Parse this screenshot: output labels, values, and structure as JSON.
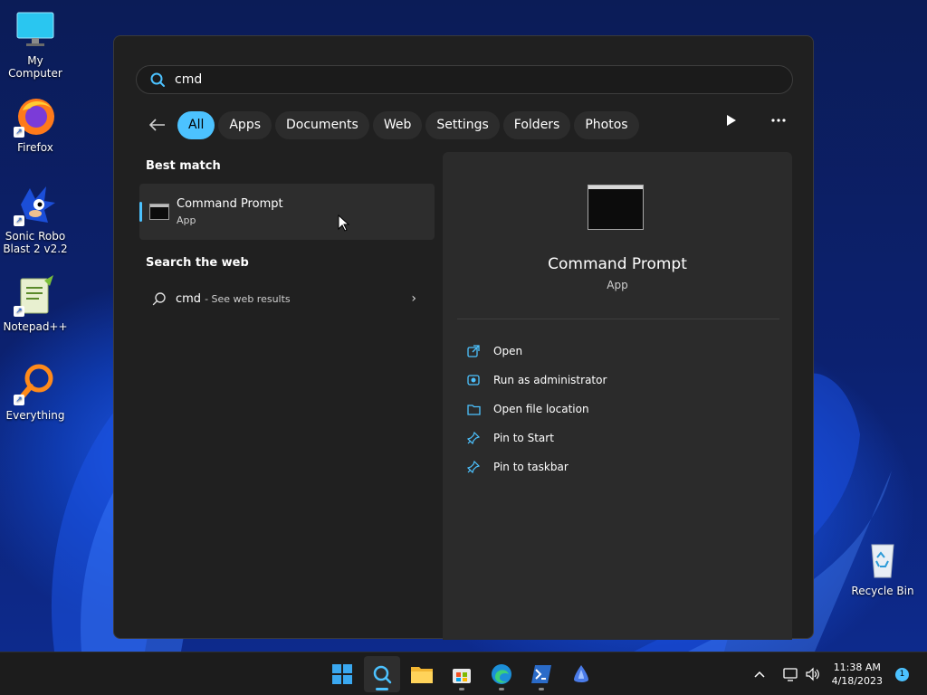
{
  "desktop": {
    "icons": [
      {
        "label": "My Computer",
        "icon": "monitor-icon"
      },
      {
        "label": "Firefox",
        "icon": "firefox-icon"
      },
      {
        "label": "Sonic Robo Blast 2 v2.2",
        "icon": "sonic-icon"
      },
      {
        "label": "Notepad++",
        "icon": "notepadpp-icon"
      },
      {
        "label": "Everything",
        "icon": "everything-icon"
      },
      {
        "label": "Recycle Bin",
        "icon": "recycle-bin-icon"
      }
    ]
  },
  "search": {
    "query": "cmd"
  },
  "filters": [
    "All",
    "Apps",
    "Documents",
    "Web",
    "Settings",
    "Folders",
    "Photos"
  ],
  "active_filter": "All",
  "results": {
    "best_match_title": "Best match",
    "best_match": {
      "name": "Command Prompt",
      "type": "App"
    },
    "web_title": "Search the web",
    "web_query": "cmd",
    "web_suffix": "- See web results"
  },
  "detail": {
    "name": "Command Prompt",
    "type": "App",
    "actions": [
      {
        "label": "Open",
        "icon": "open-external-icon"
      },
      {
        "label": "Run as administrator",
        "icon": "admin-shield-icon"
      },
      {
        "label": "Open file location",
        "icon": "folder-icon"
      },
      {
        "label": "Pin to Start",
        "icon": "pin-icon"
      },
      {
        "label": "Pin to taskbar",
        "icon": "pin-icon"
      }
    ]
  },
  "taskbar": {
    "apps": [
      "start-icon",
      "search-icon",
      "file-explorer-icon",
      "store-icon",
      "edge-icon",
      "powershell-icon",
      "app-icon"
    ],
    "time": "11:38 AM",
    "date": "4/18/2023",
    "notification_count": "1"
  },
  "colors": {
    "accent": "#4cc2ff",
    "panel": "#202020"
  }
}
